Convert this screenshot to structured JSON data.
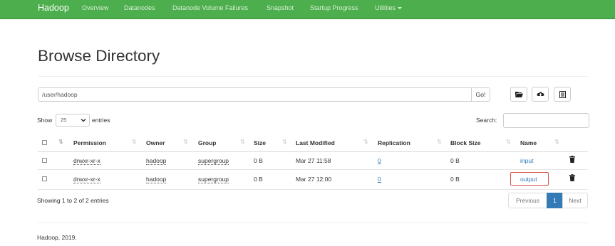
{
  "navbar": {
    "brand": "Hadoop",
    "links": [
      "Overview",
      "Datanodes",
      "Datanode Volume Failures",
      "Snapshot",
      "Startup Progress",
      "Utilities"
    ]
  },
  "page": {
    "title": "Browse Directory"
  },
  "path_bar": {
    "value": "/user/hadoop",
    "go_label": "Go!"
  },
  "icons": [
    "folder-open-icon",
    "upload-icon",
    "list-icon"
  ],
  "length_control": {
    "show_label": "Show",
    "selected": "25",
    "entries_label": "entries"
  },
  "search": {
    "label": "Search:",
    "value": ""
  },
  "table": {
    "headers": [
      "Permission",
      "Owner",
      "Group",
      "Size",
      "Last Modified",
      "Replication",
      "Block Size",
      "Name"
    ],
    "rows": [
      {
        "permission": "drwxr-xr-x",
        "owner": "hadoop",
        "group": "supergroup",
        "size": "0 B",
        "modified": "Mar 27 11:58",
        "replication": "0",
        "block_size": "0 B",
        "name": "input"
      },
      {
        "permission": "drwxr-xr-x",
        "owner": "hadoop",
        "group": "supergroup",
        "size": "0 B",
        "modified": "Mar 27 12:00",
        "replication": "0",
        "block_size": "0 B",
        "name": "output"
      }
    ]
  },
  "info": "Showing 1 to 2 of 2 entries",
  "pagination": {
    "previous": "Previous",
    "current": "1",
    "next": "Next"
  },
  "footer": "Hadoop, 2019.",
  "colors": {
    "navbar": "#4cae4c",
    "link": "#337ab7",
    "highlight_border": "#d9534f"
  }
}
